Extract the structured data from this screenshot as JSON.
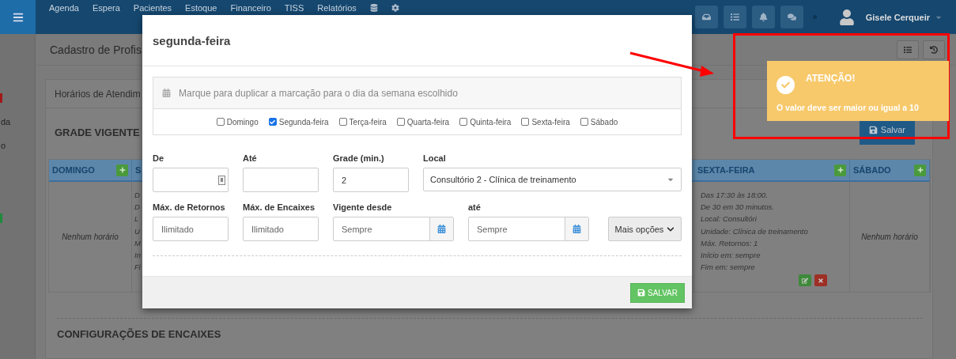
{
  "navbar": {
    "items": [
      "Agenda",
      "Espera",
      "Pacientes",
      "Estoque",
      "Financeiro",
      "TISS",
      "Relatórios"
    ],
    "user": "Gisele Cerqueir"
  },
  "sidebar": [
    {
      "kind": "marker",
      "color": "#a01818"
    },
    {
      "kind": "text",
      "text": "da"
    },
    {
      "kind": "text",
      "text": "o"
    },
    {
      "kind": "marker",
      "color": "#1e8a3c"
    }
  ],
  "page_title": "Cadastro de Profis",
  "panel": {
    "title": "Horários de Atendim",
    "section_title": "GRADE VIGENTE",
    "save_button": "Salvar",
    "columns": [
      {
        "kind": "day",
        "header": "DOMINGO",
        "empty_text": "Nenhum horário"
      },
      {
        "kind": "partial",
        "header": "S",
        "lines": [
          "D",
          "D",
          "L",
          "U",
          "M",
          "In",
          "Fi"
        ]
      },
      {
        "kind": "day",
        "header": "SEXTA-FEIRA",
        "lines": [
          "Das 17:30 às 18:00.",
          "De 30 em 30 minutos.",
          "Local: Consultóri",
          "Unidade: Clínica de treinamento",
          "Máx. Retornos: 1",
          "Início em: sempre",
          "Fim em: sempre"
        ],
        "actions": true
      },
      {
        "kind": "day",
        "header": "SÁBADO",
        "empty_text": "Nenhum horário"
      }
    ],
    "second_section": "CONFIGURAÇÕES DE ENCAIXES"
  },
  "modal": {
    "title": "segunda-feira",
    "duplicate_hint": "Marque para duplicar a marcação para o dia da semana escolhido",
    "days": [
      {
        "label": "Domingo",
        "checked": false
      },
      {
        "label": "Segunda-feira",
        "checked": true
      },
      {
        "label": "Terça-feira",
        "checked": false
      },
      {
        "label": "Quarta-feira",
        "checked": false
      },
      {
        "label": "Quinta-feira",
        "checked": false
      },
      {
        "label": "Sexta-feira",
        "checked": false
      },
      {
        "label": "Sábado",
        "checked": false
      }
    ],
    "rows": [
      [
        {
          "kind": "time",
          "label": "De"
        },
        {
          "kind": "text",
          "label": "Até"
        },
        {
          "kind": "text",
          "label": "Grade (min.)",
          "value": "2"
        },
        {
          "kind": "select",
          "label": "Local",
          "value": "Consultório 2 - Clínica de treinamento"
        }
      ],
      [
        {
          "kind": "text",
          "label": "Máx. de Retornos",
          "placeholder": "Ilimitado"
        },
        {
          "kind": "text",
          "label": "Máx. de Encaixes",
          "placeholder": "Ilimitado"
        },
        {
          "kind": "date",
          "label": "Vigente desde",
          "placeholder": "Sempre"
        },
        {
          "kind": "date",
          "label": "até",
          "placeholder": "Sempre"
        },
        {
          "kind": "button",
          "label": "Mais opções"
        }
      ]
    ],
    "save_button": "SALVAR"
  },
  "toast": {
    "title": "ATENÇÃO!",
    "message": "O valor deve ser maior ou igual a 10"
  }
}
